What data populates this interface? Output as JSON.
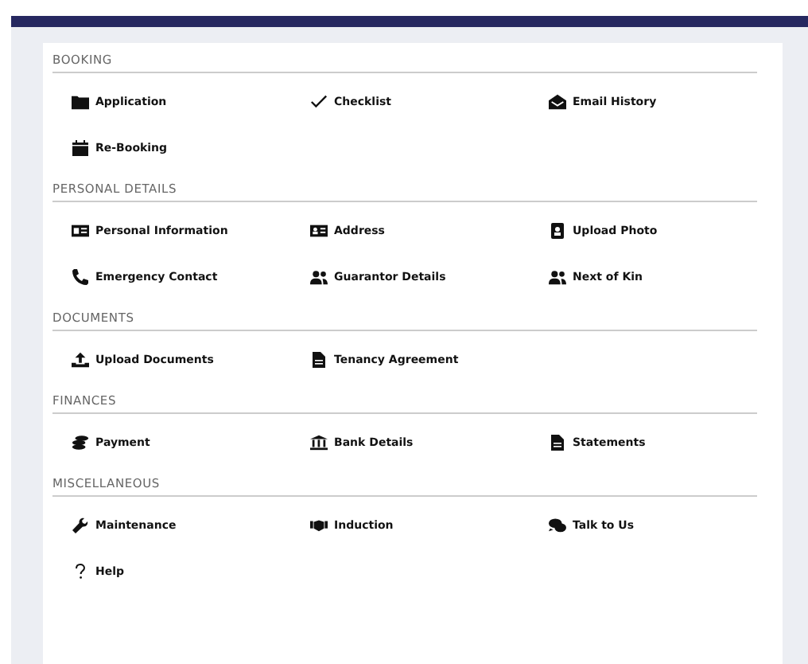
{
  "sections": [
    {
      "title": "BOOKING",
      "items": [
        "Application",
        "Checklist",
        "Email History",
        "Re-Booking"
      ]
    },
    {
      "title": "PERSONAL DETAILS",
      "items": [
        "Personal Information",
        "Address",
        "Upload Photo",
        "Emergency Contact",
        "Guarantor Details",
        "Next of Kin"
      ]
    },
    {
      "title": "DOCUMENTS",
      "items": [
        "Upload Documents",
        "Tenancy Agreement"
      ]
    },
    {
      "title": "FINANCES",
      "items": [
        "Payment",
        "Bank Details",
        "Statements"
      ]
    },
    {
      "title": "MISCELLANEOUS",
      "items": [
        "Maintenance",
        "Induction",
        "Talk to Us",
        "Help"
      ]
    }
  ]
}
